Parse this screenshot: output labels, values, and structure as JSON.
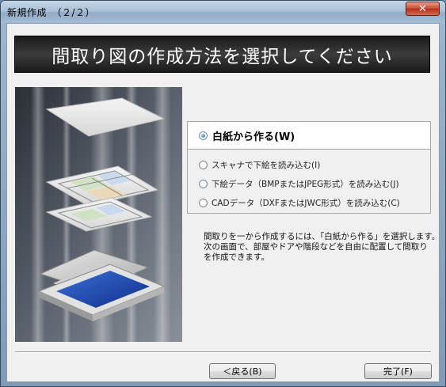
{
  "window": {
    "title": "新規作成　（２/２）",
    "close_glyph": "✕"
  },
  "header": {
    "title": "間取り図の作成方法を選択してください"
  },
  "options": {
    "selected": "blank",
    "items": [
      {
        "id": "blank",
        "label": "白紙から作る(W)",
        "checked": true
      },
      {
        "id": "scanner",
        "label": "スキャナで下絵を読み込む(I)",
        "checked": false
      },
      {
        "id": "image",
        "label": "下絵データ（BMPまたはJPEG形式）を読み込む(J)",
        "checked": false
      },
      {
        "id": "cad",
        "label": "CADデータ（DXFまたはJWC形式）を読み込む(C)",
        "checked": false
      }
    ]
  },
  "description": {
    "lines": [
      "間取りを一から作成するには、「白紙から作る」を選択します。",
      "次の画面で、部屋やドアや階段などを自由に配置して間取り",
      "を作成できます。"
    ]
  },
  "buttons": {
    "back": "＜戻る(B)",
    "finish": "完了(F)"
  },
  "colors": {
    "header_bg": "#2a2a2a",
    "radio_fill": "#1f6fb3",
    "scanner_glass": "#1d45a8"
  }
}
